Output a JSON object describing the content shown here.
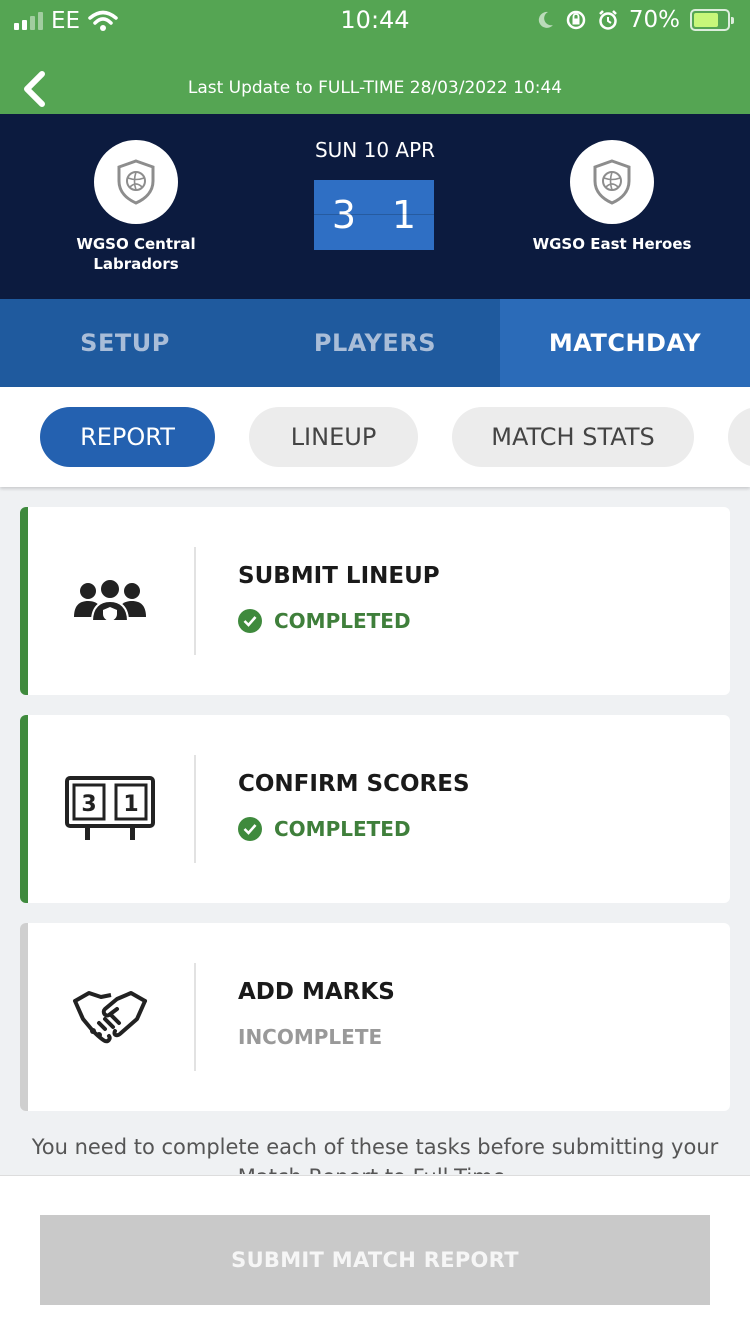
{
  "status_bar": {
    "carrier": "EE",
    "time": "10:44",
    "battery": "70%"
  },
  "header": {
    "last_update": "Last Update to FULL-TIME 28/03/2022 10:44"
  },
  "match": {
    "date": "SUN 10 APR",
    "home_team": "WGSO Central Labradors",
    "away_team": "WGSO East Heroes",
    "home_score": "3",
    "away_score": "1"
  },
  "main_tabs": [
    {
      "label": "SETUP"
    },
    {
      "label": "PLAYERS"
    },
    {
      "label": "MATCHDAY"
    }
  ],
  "sub_tabs": [
    {
      "label": "REPORT"
    },
    {
      "label": "LINEUP"
    },
    {
      "label": "MATCH STATS"
    }
  ],
  "tasks": [
    {
      "title": "SUBMIT LINEUP",
      "status": "COMPLETED",
      "icon": "team-icon"
    },
    {
      "title": "CONFIRM SCORES",
      "status": "COMPLETED",
      "icon": "scoreboard-icon",
      "score_left": "3",
      "score_right": "1"
    },
    {
      "title": "ADD MARKS",
      "status": "INCOMPLETE",
      "icon": "handshake-icon"
    }
  ],
  "note": "You need to complete each of these tasks before submitting your Match Report to Full-Time.",
  "footer": {
    "submit_label": "SUBMIT MATCH REPORT"
  },
  "colors": {
    "header_green": "#55a553",
    "navy": "#0c1b3f",
    "tab_blue": "#2b6bb8",
    "completed_green": "#3f8a3d",
    "disabled_grey": "#c9c9c9"
  }
}
